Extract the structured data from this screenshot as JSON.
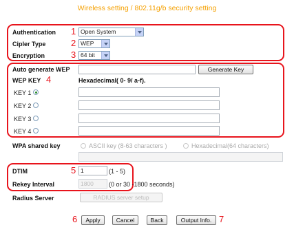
{
  "page": {
    "title": "Wireless setting / 802.11g/b security setting"
  },
  "markers": {
    "m1": "1",
    "m2": "2",
    "m3": "3",
    "m4": "4",
    "m5": "5",
    "m6": "6",
    "m7": "7"
  },
  "authentication": {
    "label": "Authentication",
    "value": "Open System"
  },
  "cipher_type": {
    "label": "Cipler Type",
    "value": "WEP"
  },
  "encryption": {
    "label": "Encryption",
    "value": "64 bit"
  },
  "auto_wep": {
    "label": "Auto generate WEP",
    "value": "",
    "button": "Generate Key"
  },
  "wep_key": {
    "label": "WEP KEY",
    "format_hint": "Hexadecimal( 0- 9/ a-f).",
    "keys": [
      {
        "label": "KEY 1",
        "selected": true,
        "value": ""
      },
      {
        "label": "KEY 2",
        "selected": false,
        "value": ""
      },
      {
        "label": "KEY 3",
        "selected": false,
        "value": ""
      },
      {
        "label": "KEY 4",
        "selected": false,
        "value": ""
      }
    ]
  },
  "wpa_shared_key": {
    "label": "WPA shared key",
    "option_ascii": "ASCII key (8-63 characters )",
    "option_hex": "Hexadecimal(64 characters)",
    "value": ""
  },
  "dtim": {
    "label": "DTIM",
    "value": "1",
    "hint": "(1 - 5)"
  },
  "rekey_interval": {
    "label": "Rekey Interval",
    "value": "1800",
    "hint": "(0 or 30 -1800 seconds)"
  },
  "radius_server": {
    "label": "Radius Server",
    "button": "RADIUS server setup"
  },
  "buttons": {
    "apply": "Apply",
    "cancel": "Cancel",
    "back": "Back",
    "output": "Output Info."
  }
}
